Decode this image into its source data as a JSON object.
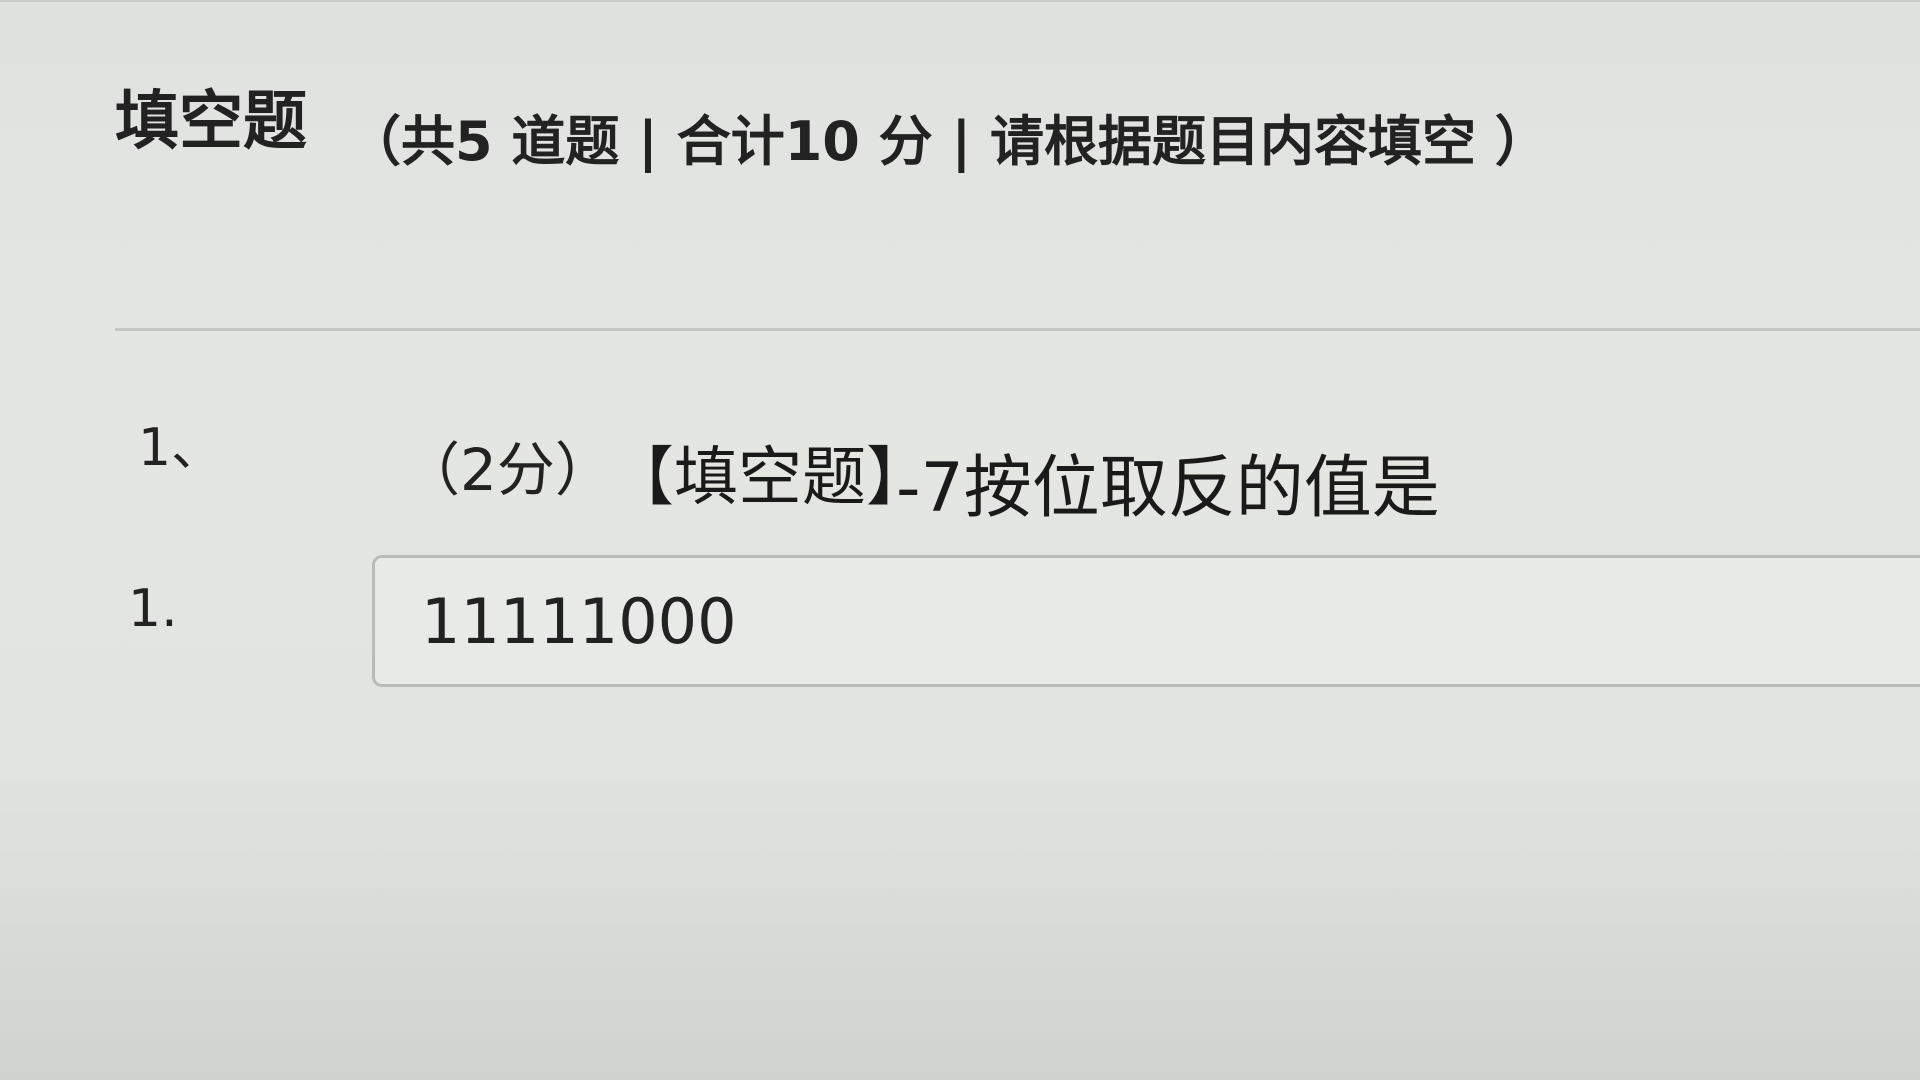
{
  "section": {
    "title": "填空题",
    "meta": "（共5 道题 | 合计10 分 | 请根据题目内容填空 ）"
  },
  "question": {
    "number": "1、",
    "points": "（2分）",
    "type_label": "【填空题】",
    "text": "-7按位取反的值是"
  },
  "answer": {
    "number": "1.",
    "value": "11111000"
  }
}
